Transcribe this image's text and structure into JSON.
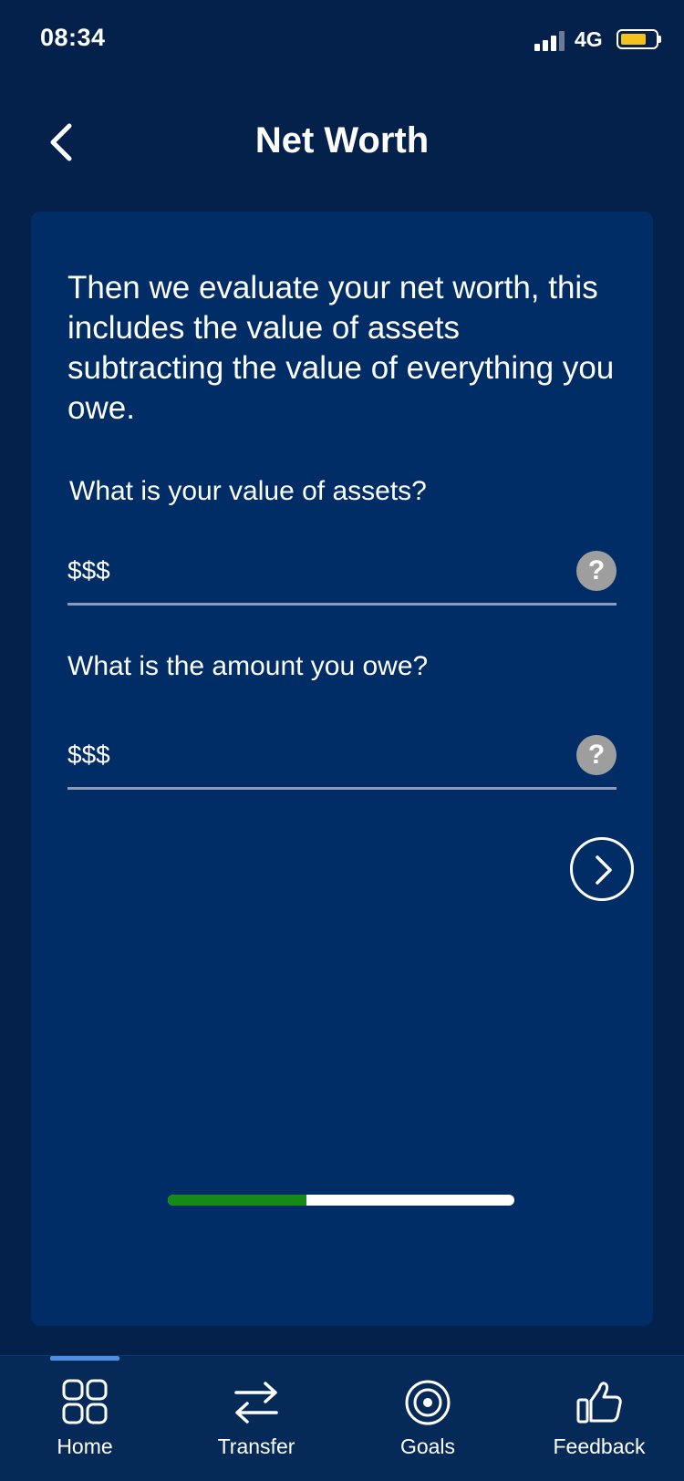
{
  "status_bar": {
    "time": "08:34",
    "network": "4G",
    "signal_bars": 3,
    "battery_level": 0.75,
    "battery_color": "#f4c21b"
  },
  "header": {
    "title": "Net Worth",
    "back_icon": "chevron-left-icon"
  },
  "card": {
    "intro": "Then we evaluate your net worth, this includes the value of assets subtracting the value of everything you owe.",
    "assets": {
      "question": "What is your value of assets?",
      "placeholder": "$$$",
      "value": "",
      "help_symbol": "?"
    },
    "owe": {
      "question": "What is the amount you owe?",
      "placeholder": "$$$",
      "value": "",
      "help_symbol": "?"
    },
    "next_icon": "chevron-right-circle-icon",
    "progress": 0.4,
    "progress_color": "#168a16"
  },
  "nav": {
    "active": "home",
    "accent": "#4f8fe3",
    "items": [
      {
        "id": "home",
        "label": "Home",
        "icon": "grid-icon"
      },
      {
        "id": "transfer",
        "label": "Transfer",
        "icon": "transfer-arrows-icon"
      },
      {
        "id": "goals",
        "label": "Goals",
        "icon": "target-icon"
      },
      {
        "id": "feedback",
        "label": "Feedback",
        "icon": "thumbs-up-icon"
      }
    ]
  }
}
